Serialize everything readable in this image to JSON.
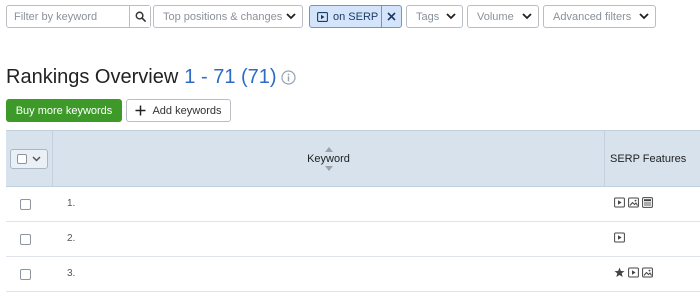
{
  "filters": {
    "search_placeholder": "Filter by keyword",
    "top_positions_label": "Top positions & changes",
    "serp_chip_label": "on SERP",
    "tags_label": "Tags",
    "volume_label": "Volume",
    "advanced_label": "Advanced filters"
  },
  "title": {
    "text": "Rankings Overview",
    "count": "1 - 71 (71)"
  },
  "buttons": {
    "buy_more": "Buy more keywords",
    "add_keywords": "Add keywords"
  },
  "table": {
    "columns": {
      "keyword": "Keyword",
      "serp_features": "SERP Features"
    },
    "rows": [
      {
        "num": "1.",
        "features": [
          "video-icon",
          "image-icon",
          "news-icon"
        ]
      },
      {
        "num": "2.",
        "features": [
          "video-icon"
        ]
      },
      {
        "num": "3.",
        "features": [
          "star-icon",
          "video-icon",
          "image-icon"
        ]
      }
    ]
  },
  "colors": {
    "accent_blue": "#2e6bc4",
    "buy_green": "#3d9a28",
    "chip_bg": "#d4e4fa",
    "header_bg": "#d7e2ed"
  }
}
